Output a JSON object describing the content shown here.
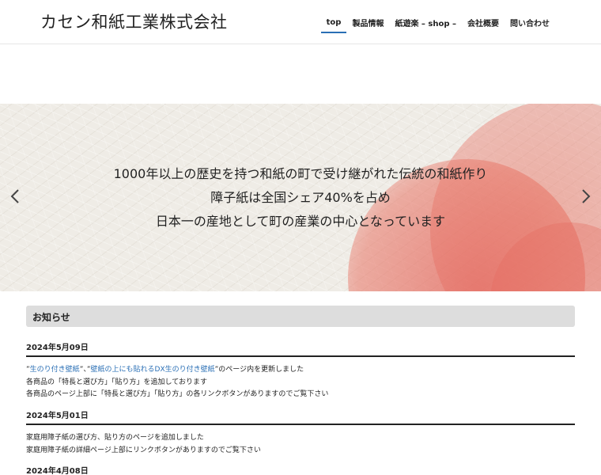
{
  "header": {
    "logo": "カセン和紙工業株式会社",
    "nav": [
      {
        "label": "top",
        "active": true
      },
      {
        "label": "製品情報",
        "active": false
      },
      {
        "label": "紙遊楽 – shop –",
        "active": false
      },
      {
        "label": "会社概要",
        "active": false
      },
      {
        "label": "問い合わせ",
        "active": false
      }
    ]
  },
  "hero": {
    "lines": [
      "1000年以上の歴史を持つ和紙の町で受け継がれた伝統の和紙作り",
      "障子紙は全国シェア40%を占め",
      "日本一の産地として町の産業の中心となっています"
    ],
    "prev_icon": "chevron-left-icon",
    "next_icon": "chevron-right-icon"
  },
  "news": {
    "title": "お知らせ",
    "entries": [
      {
        "date": "2024年5月09日",
        "line1": {
          "q1": "”",
          "link1": "生のり付き壁紙",
          "q2": "”、”",
          "link2": "壁紙の上にも貼れるDX生のり付き壁紙",
          "rest": "”のページ内を更新しました"
        },
        "line2": "各商品の「特長と選び方」「貼り方」を追加しております",
        "line3": "各商品のページ上部に「特長と選び方」「貼り方」の各リンクボタンがありますのでご覧下さい"
      },
      {
        "date": "2024年5月01日",
        "line1": "家庭用障子紙の選び方、貼り方のページを追加しました",
        "line2": "家庭用障子紙の詳細ページ上部にリンクボタンがありますのでご覧下さい"
      },
      {
        "date": "2024年4月08日"
      }
    ]
  },
  "colors": {
    "accent": "#2a6fb5",
    "news_header_bg": "#dddddd",
    "hero_bg": "#efece6",
    "hero_circle": "#e6786a"
  }
}
